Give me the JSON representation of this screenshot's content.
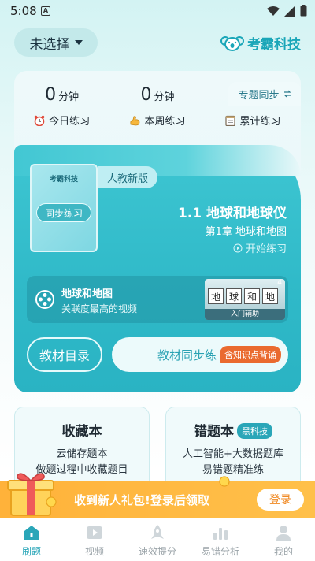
{
  "status_bar": {
    "time": "5:08",
    "notification": "A"
  },
  "header": {
    "select_label": "未选择",
    "brand": "考霸科技"
  },
  "stats": [
    {
      "value": "0",
      "unit": "分钟",
      "label": "今日练习",
      "icon": "alarm-clock-icon"
    },
    {
      "value": "0",
      "unit": "分钟",
      "label": "本周练习",
      "icon": "flexed-arm-icon"
    },
    {
      "value": "0",
      "unit": "小时",
      "label": "累计练习",
      "icon": "notepad-icon"
    }
  ],
  "sync": {
    "topic_tab": "专题同步",
    "book_brand": "考霸科技",
    "book_label": "同步练习",
    "edition": "人教新版",
    "lesson_title": "1.1 地球和地球仪",
    "chapter": "第1章 地球和地图",
    "start_practice": "开始练习",
    "video": {
      "title": "地球和地图",
      "subtitle": "关联度最高的视频",
      "thumb_count": "4",
      "thumb_chars": [
        "地",
        "球",
        "和",
        "地",
        "图"
      ],
      "thumb_caption": "入门辅助"
    },
    "catalog_button": "教材目录",
    "sync_button": "教材同步练",
    "sync_badge": "含知识点背诵"
  },
  "cards": {
    "favorites": {
      "title": "收藏本",
      "line1": "云储存题本",
      "line2": "做题过程中收藏题目"
    },
    "mistakes": {
      "title": "错题本",
      "tag": "黑科技",
      "line1": "人工智能+大数据题库",
      "line2": "易错题精准练"
    }
  },
  "banner": {
    "text": "收到新人礼包!登录后领取",
    "button": "登录"
  },
  "bottom_nav": [
    {
      "label": "刷题",
      "icon": "home-icon",
      "active": true
    },
    {
      "label": "视频",
      "icon": "play-icon",
      "active": false
    },
    {
      "label": "速效提分",
      "icon": "rocket-icon",
      "active": false
    },
    {
      "label": "易错分析",
      "icon": "bar-chart-icon",
      "active": false
    },
    {
      "label": "我的",
      "icon": "person-icon",
      "active": false
    }
  ],
  "colors": {
    "accent": "#2aa6b8",
    "banner": "#ffb23a",
    "badge": "#ea6a2f"
  }
}
